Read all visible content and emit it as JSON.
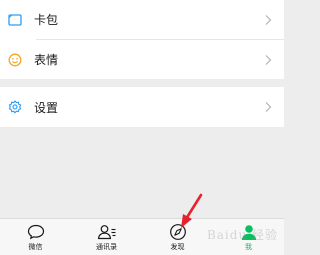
{
  "list_group_1": {
    "items": [
      {
        "label": "卡包",
        "icon": "card-wallet-icon"
      },
      {
        "label": "表情",
        "icon": "sticker-smile-icon"
      }
    ]
  },
  "list_group_2": {
    "items": [
      {
        "label": "设置",
        "icon": "gear-icon"
      }
    ]
  },
  "tabbar": {
    "tabs": [
      {
        "label": "微信",
        "icon": "chat-bubble-icon",
        "active": false
      },
      {
        "label": "通讯录",
        "icon": "contacts-icon",
        "active": false
      },
      {
        "label": "发现",
        "icon": "compass-icon",
        "active": false
      },
      {
        "label": "我",
        "icon": "person-icon",
        "active": true
      }
    ]
  },
  "colors": {
    "accent": "#07c160",
    "card_icon": "#2a9df4",
    "sticker_icon": "#f5a623",
    "settings_icon": "#2a9df4",
    "annotation_arrow": "#e8222c"
  },
  "watermark": "Baidu 经验"
}
